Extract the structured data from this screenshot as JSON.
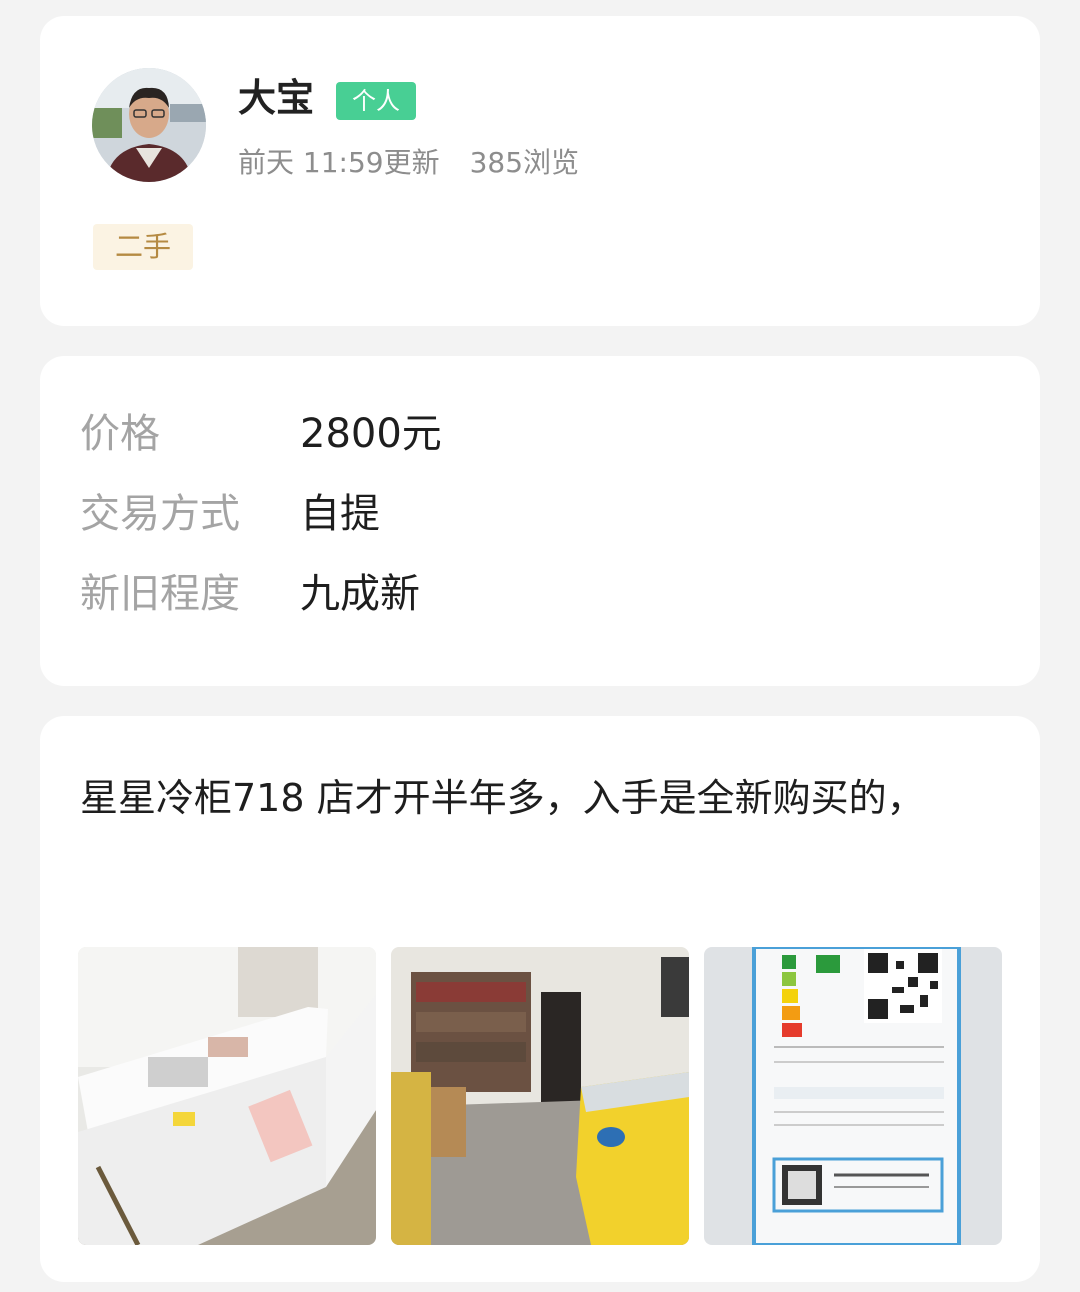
{
  "seller": {
    "name": "大宝",
    "badge": "个人",
    "updated": "前天 11:59更新",
    "views": "385浏览",
    "condition_tag": "二手"
  },
  "details": {
    "price_label": "价格",
    "price_value": "2800元",
    "trade_label": "交易方式",
    "trade_value": "自提",
    "condition_label": "新旧程度",
    "condition_value": "九成新"
  },
  "description": {
    "text": "星星冷柜718 店才开半年多，入手是全新购买的，",
    "photos": [
      {
        "subject": "white chest freezer"
      },
      {
        "subject": "shop interior with yellow freezer"
      },
      {
        "subject": "energy label with QR code"
      }
    ]
  },
  "colors": {
    "badge_green": "#48cf94",
    "tag_bg": "#fbf3e3",
    "tag_text": "#b58a42"
  }
}
